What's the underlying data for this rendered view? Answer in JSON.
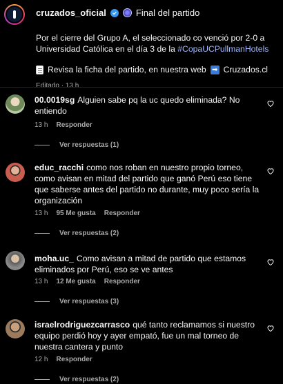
{
  "post": {
    "username": "cruzados_oficial",
    "title": "Final del partido",
    "text_pre": "Por el cierre del Grupo A, el seleccionado co venció por 2-0 a Universidad Católica en el día 3 de la ",
    "hashtag": "#CopaUCPullmanHotels",
    "link_text": "Revisa la ficha del partido, en nuestra web",
    "link_site": "Cruzados.cl",
    "meta": "Editado · 13 h",
    "icons": {
      "verified": "verified-badge-icon",
      "ball": "soccer-ball-icon",
      "doc": "document-emoji-icon",
      "arrow": "right-arrow-emoji-icon"
    }
  },
  "comments": [
    {
      "username": "00.0019sg",
      "text": "Alguien sabe pq la uc quedo eliminada? No entiendo",
      "time": "13 h",
      "likes": "",
      "reply_label": "Responder",
      "view_replies": "Ver respuestas (1)",
      "avatar_color": "#b7c9a3"
    },
    {
      "username": "educ_racchi",
      "text": "como nos roban en nuestro propio torneo, como avisan en mitad del partido que ganó Perú eso tiene que saberse antes del partido no durante, muy poco sería la organización",
      "time": "13 h",
      "likes": "95 Me gusta",
      "reply_label": "Responder",
      "view_replies": "Ver respuestas (2)",
      "avatar_color": "#c95d4f"
    },
    {
      "username": "moha.uc_",
      "text": "Como avisan a mitad de partido que estamos eliminados por Perú, eso se ve antes",
      "time": "13 h",
      "likes": "12 Me gusta",
      "reply_label": "Responder",
      "view_replies": "Ver respuestas (3)",
      "avatar_color": "#8a8a8a"
    },
    {
      "username": "israelrodriguezcarrasco",
      "text": "qué tanto reclamamos si nuestro equipo perdió hoy y ayer empató, fue un mal torneo de nuestra cantera y punto",
      "time": "12 h",
      "likes": "",
      "reply_label": "Responder",
      "view_replies": "Ver respuestas (2)",
      "avatar_color": "#9c7a5e"
    }
  ]
}
